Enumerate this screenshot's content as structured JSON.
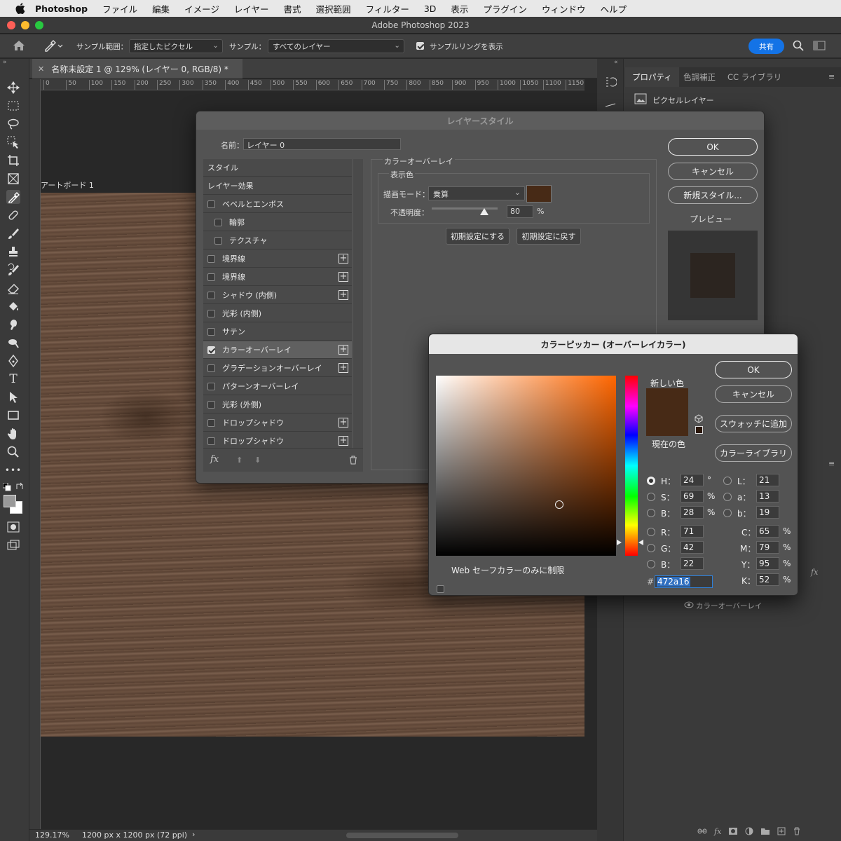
{
  "menubar": {
    "app_name": "Photoshop",
    "items": [
      "ファイル",
      "編集",
      "イメージ",
      "レイヤー",
      "書式",
      "選択範囲",
      "フィルター",
      "3D",
      "表示",
      "プラグイン",
      "ウィンドウ",
      "ヘルプ"
    ]
  },
  "window": {
    "title": "Adobe Photoshop 2023"
  },
  "options": {
    "sample_size_label": "サンプル範囲：",
    "sample_size_value": "指定したピクセル",
    "sample_label": "サンプル：",
    "sample_value": "すべてのレイヤー",
    "show_ring_label": "サンプルリングを表示",
    "share_label": "共有"
  },
  "document": {
    "tab_title": "名称未設定 1 @ 129% (レイヤー 0, RGB/8) *",
    "artboard_label": "アートボード 1",
    "zoom": "129.17%",
    "doc_info": "1200 px x 1200 px (72 ppi)"
  },
  "ruler": {
    "h_ticks": [
      "0",
      "50",
      "100",
      "150",
      "200",
      "250",
      "300",
      "350",
      "400",
      "450",
      "500",
      "550",
      "600",
      "650",
      "700",
      "750",
      "800",
      "850",
      "900",
      "950",
      "1000",
      "1050",
      "1100",
      "1150"
    ]
  },
  "right_panel": {
    "tabs": [
      "プロパティ",
      "色調補正",
      "CC ライブラリ"
    ],
    "kind": "ピクセルレイヤー",
    "effect_label": "カラーオーバーレイ"
  },
  "layer_style": {
    "title": "レイヤースタイル",
    "name_label": "名前：",
    "name_value": "レイヤー 0",
    "list": [
      {
        "label": "スタイル",
        "check": false,
        "plus": false,
        "sel": false,
        "indent": 0,
        "hascb": false
      },
      {
        "label": "レイヤー効果",
        "check": false,
        "plus": false,
        "sel": false,
        "indent": 0,
        "hascb": false
      },
      {
        "label": "ベベルとエンボス",
        "check": false,
        "plus": false,
        "sel": false,
        "indent": 0,
        "hascb": true
      },
      {
        "label": "輪郭",
        "check": false,
        "plus": false,
        "sel": false,
        "indent": 1,
        "hascb": true
      },
      {
        "label": "テクスチャ",
        "check": false,
        "plus": false,
        "sel": false,
        "indent": 1,
        "hascb": true
      },
      {
        "label": "境界線",
        "check": false,
        "plus": true,
        "sel": false,
        "indent": 0,
        "hascb": true
      },
      {
        "label": "境界線",
        "check": false,
        "plus": true,
        "sel": false,
        "indent": 0,
        "hascb": true
      },
      {
        "label": "シャドウ (内側)",
        "check": false,
        "plus": true,
        "sel": false,
        "indent": 0,
        "hascb": true
      },
      {
        "label": "光彩 (内側)",
        "check": false,
        "plus": false,
        "sel": false,
        "indent": 0,
        "hascb": true
      },
      {
        "label": "サテン",
        "check": false,
        "plus": false,
        "sel": false,
        "indent": 0,
        "hascb": true
      },
      {
        "label": "カラーオーバーレイ",
        "check": true,
        "plus": true,
        "sel": true,
        "indent": 0,
        "hascb": true
      },
      {
        "label": "グラデーションオーバーレイ",
        "check": false,
        "plus": true,
        "sel": false,
        "indent": 0,
        "hascb": true
      },
      {
        "label": "パターンオーバーレイ",
        "check": false,
        "plus": false,
        "sel": false,
        "indent": 0,
        "hascb": true
      },
      {
        "label": "光彩 (外側)",
        "check": false,
        "plus": false,
        "sel": false,
        "indent": 0,
        "hascb": true
      },
      {
        "label": "ドロップシャドウ",
        "check": false,
        "plus": true,
        "sel": false,
        "indent": 0,
        "hascb": true
      },
      {
        "label": "ドロップシャドウ",
        "check": false,
        "plus": true,
        "sel": false,
        "indent": 0,
        "hascb": true
      }
    ],
    "fx_label": "fx",
    "section_title": "カラーオーバーレイ",
    "subsection_title": "表示色",
    "blend_label": "描画モード：",
    "blend_value": "乗算",
    "opacity_label": "不透明度：",
    "opacity_value": "80",
    "opacity_unit": "%",
    "opacity_fraction": 0.8,
    "make_default": "初期設定にする",
    "reset_default": "初期設定に戻す",
    "ok": "OK",
    "cancel": "キャンセル",
    "new_style": "新規スタイル...",
    "preview_label": "プレビュー"
  },
  "color_picker": {
    "title": "カラーピッカー (オーバーレイカラー)",
    "new_label": "新しい色",
    "current_label": "現在の色",
    "ok": "OK",
    "cancel": "キャンセル",
    "add_swatch": "スウォッチに追加",
    "color_library": "カラーライブラリ",
    "web_only": "Web セーフカラーのみに制限",
    "hex_label": "#",
    "hex": "472a16",
    "H": "24",
    "S": "69",
    "Bv": "28",
    "R": "71",
    "G": "42",
    "Bc": "22",
    "L": "21",
    "a": "13",
    "b": "19",
    "C": "65",
    "M": "79",
    "Y": "95",
    "K": "52",
    "deg": "°",
    "pct": "%",
    "lbl_H": "H：",
    "lbl_S": "S：",
    "lbl_B": "B：",
    "lbl_R": "R：",
    "lbl_G": "G：",
    "lbl_Bc": "B：",
    "lbl_L": "L：",
    "lbl_a": "a：",
    "lbl_b": "b：",
    "lbl_C": "C：",
    "lbl_M": "M：",
    "lbl_Y": "Y：",
    "lbl_K": "K：",
    "swatch_color": "#472a16"
  }
}
